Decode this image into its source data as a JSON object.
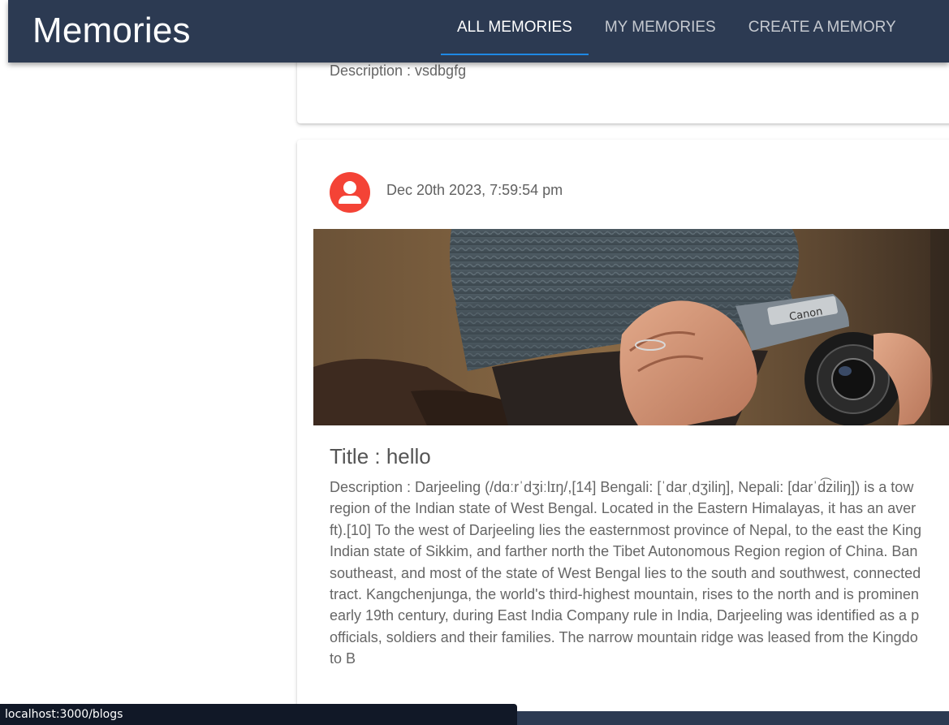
{
  "app": {
    "title": "Memories"
  },
  "nav": {
    "tabs": [
      {
        "label": "ALL MEMORIES",
        "active": true
      },
      {
        "label": "MY MEMORIES",
        "active": false
      },
      {
        "label": "CREATE A MEMORY",
        "active": false
      }
    ]
  },
  "posts": [
    {
      "description": "Description : vsdbgfg"
    },
    {
      "avatar_icon": "person-icon",
      "timestamp": "Dec 20th 2023, 7:59:54 pm",
      "image_subject": "camera-photo",
      "title": "Title : hello",
      "description_lines": [
        "Description : Darjeeling (/dɑːrˈdʒiːlɪŋ/,[14] Bengali: [ˈdarˌdʒiliŋ], Nepali: [darˈd͡ziliŋ]) is a tow",
        "region of the Indian state of West Bengal. Located in the Eastern Himalayas, it has an aver",
        "ft).[10] To the west of Darjeeling lies the easternmost province of Nepal, to the east the King",
        "Indian state of Sikkim, and farther north the Tibet Autonomous Region region of China. Ban",
        "southeast, and most of the state of West Bengal lies to the south and southwest, connected",
        "tract. Kangchenjunga, the world's third-highest mountain, rises to the north and is prominen",
        "early 19th century, during East India Company rule in India, Darjeeling was identified as a p",
        "officials, soldiers and their families. The narrow mountain ridge was leased from the Kingdo",
        "to B"
      ]
    }
  ],
  "statusbar": {
    "url": "localhost:3000/blogs"
  },
  "colors": {
    "appbar": "#2c3a52",
    "tab_indicator": "#1e88e5",
    "avatar": "#f44336"
  }
}
